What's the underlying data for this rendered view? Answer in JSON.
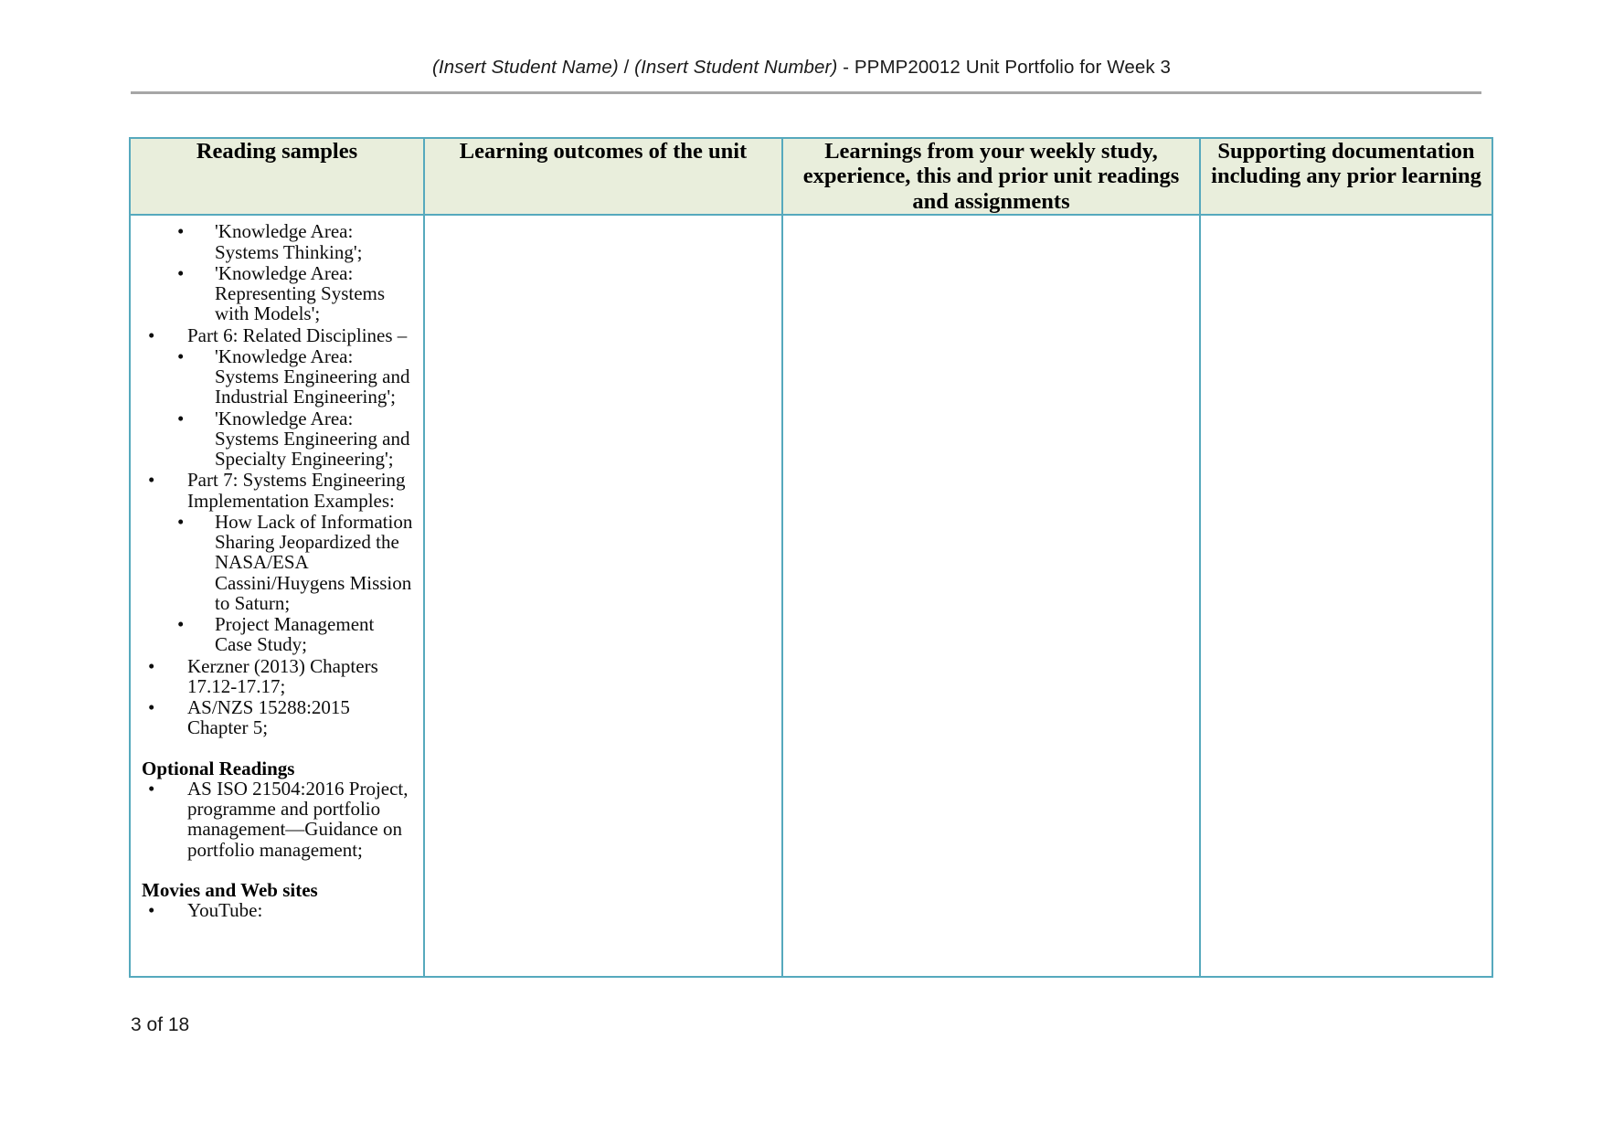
{
  "document": {
    "header": {
      "student_name_placeholder": "(Insert Student Name)",
      "separator": " / ",
      "student_number_placeholder": "(Insert Student Number)",
      "title_suffix": " - PPMP20012 Unit Portfolio for Week 3",
      "full_text": "(Insert Student Name) / (Insert Student Number) - PPMP20012 Unit Portfolio for Week 3"
    },
    "footer": {
      "page_indicator": "3 of 18"
    }
  },
  "colors": {
    "table_border": "#56a9bd",
    "header_fill": "#e9eedc",
    "header_rule": "#a6a6a6",
    "text": "#0d0d0d"
  },
  "table": {
    "columns": [
      {
        "header": "Reading samples"
      },
      {
        "header": "Learning outcomes of the unit"
      },
      {
        "header": "Learnings from your weekly study, experience, this and prior unit readings and assignments"
      },
      {
        "header": "Supporting documentation including any prior learning"
      }
    ],
    "reading_samples": {
      "blocks": [
        {
          "type": "list",
          "items": [
            {
              "level": 2,
              "text": "'Knowledge Area: Systems Thinking';"
            },
            {
              "level": 2,
              "text": "'Knowledge Area: Representing Systems with Models';"
            },
            {
              "level": 1,
              "text": "Part 6: Related Disciplines –"
            },
            {
              "level": 2,
              "text": "'Knowledge Area: Systems Engineering and Industrial Engineering';"
            },
            {
              "level": 2,
              "text": "'Knowledge Area: Systems Engineering and Specialty Engineering';"
            },
            {
              "level": 1,
              "text": "Part 7: Systems Engineering Implementation Examples:"
            },
            {
              "level": 2,
              "text": "How Lack of Information Sharing Jeopardized the NASA/ESA Cassini/Huygens Mission to Saturn;"
            },
            {
              "level": 2,
              "text": "Project Management Case Study;"
            },
            {
              "level": 1,
              "text": "Kerzner (2013) Chapters 17.12-17.17;"
            },
            {
              "level": 1,
              "text": "AS/NZS 15288:2015 Chapter 5;"
            }
          ]
        },
        {
          "type": "section",
          "heading": "Optional Readings",
          "items": [
            {
              "level": 1,
              "text": "AS ISO 21504:2016 Project, programme and portfolio management—Guidance on portfolio management;"
            }
          ]
        },
        {
          "type": "section",
          "heading": "Movies and Web sites",
          "items": [
            {
              "level": 1,
              "text": "YouTube:"
            }
          ]
        }
      ]
    },
    "learning_outcomes": {
      "content": ""
    },
    "weekly_learnings": {
      "content": ""
    },
    "supporting_documentation": {
      "content": ""
    }
  },
  "icons": {
    "bullet_glyph": "•"
  }
}
